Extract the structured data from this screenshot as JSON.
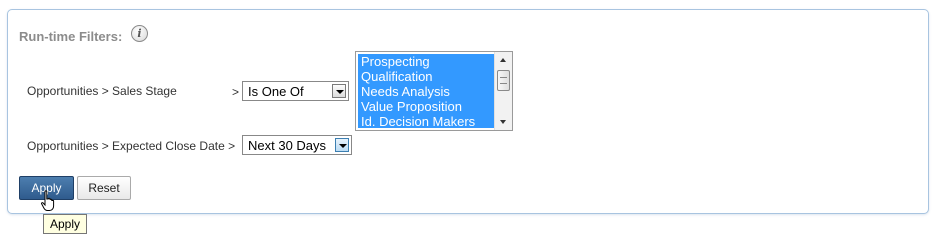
{
  "panel": {
    "title": "Run-time Filters:",
    "info_icon": "i"
  },
  "filters": [
    {
      "label": "Opportunities > Sales Stage",
      "separator": ">",
      "operator": "Is One Of",
      "selected_values": [
        "Prospecting",
        "Qualification",
        "Needs Analysis",
        "Value Proposition",
        "Id. Decision Makers"
      ]
    },
    {
      "label": "Opportunities > Expected Close Date >",
      "operator": "Next 30 Days"
    }
  ],
  "buttons": {
    "apply": "Apply",
    "reset": "Reset"
  },
  "tooltip": "Apply",
  "colors": {
    "panel_border": "#a8c4e0",
    "selection": "#3399ff",
    "apply_button": "#2f5b8d"
  }
}
